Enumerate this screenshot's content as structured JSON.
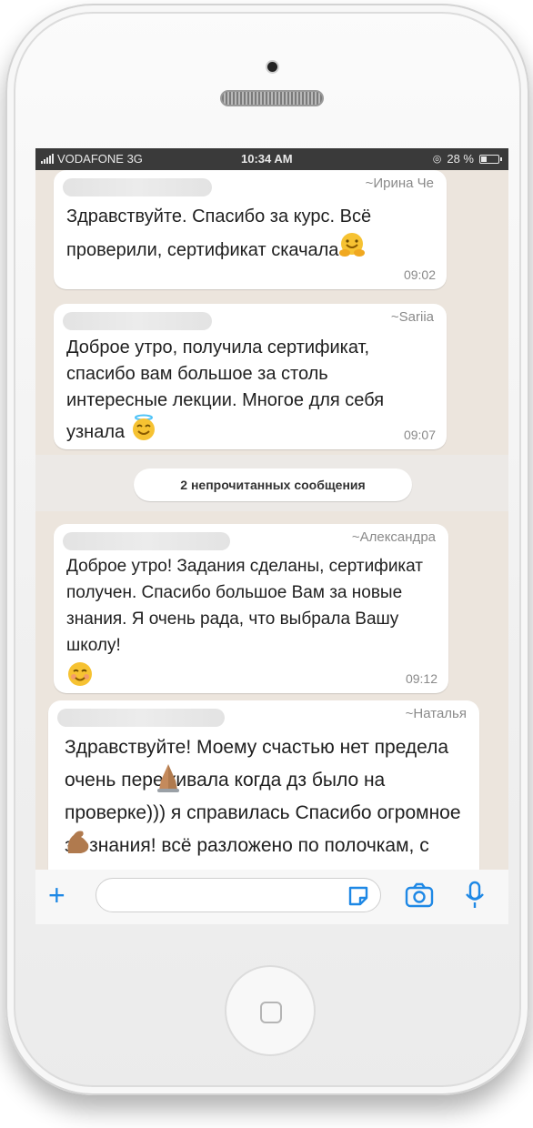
{
  "status_bar": {
    "carrier": "VODAFONE 3G",
    "time": "10:34 AM",
    "battery": "28 %"
  },
  "messages": [
    {
      "sender": "~Ирина Че",
      "text": "Здравствуйте. Спасибо за курс. Всё проверили, сертификат скачала",
      "emoji": "hugging-face",
      "time": "09:02"
    },
    {
      "sender": "~Sariia",
      "text": "Доброе утро, получила сертификат, спасибо вам большое за столь интересные лекции. Многое для себя узнала",
      "emoji": "halo-face",
      "time": "09:07"
    },
    {
      "sender": "~Александра",
      "text": "Доброе утро! Задания сделаны, сертификат получен. Спасибо большое Вам за новые знания. Я очень рада, что выбрала Вашу школу!",
      "emoji": "smiling-face",
      "time": "09:12"
    },
    {
      "sender": "~Наталья",
      "text": "Здравствуйте! Моему счастью нет предела очень переживала когда дз было на проверке))) я справилась Спасибо огромное за знания! всё разложено по полочкам, с",
      "emoji": "praying-hands",
      "emoji2": "flexed-biceps"
    }
  ],
  "unread_label": "2 непрочитанных сообщения",
  "input_bar": {
    "icons": [
      "plus-icon",
      "sticker-icon",
      "camera-icon",
      "microphone-icon"
    ]
  },
  "colors": {
    "chat_bg": "#ece5dd",
    "bubble": "#ffffff",
    "accent": "#1e88e5",
    "statusbar": "#3a3a3a"
  }
}
